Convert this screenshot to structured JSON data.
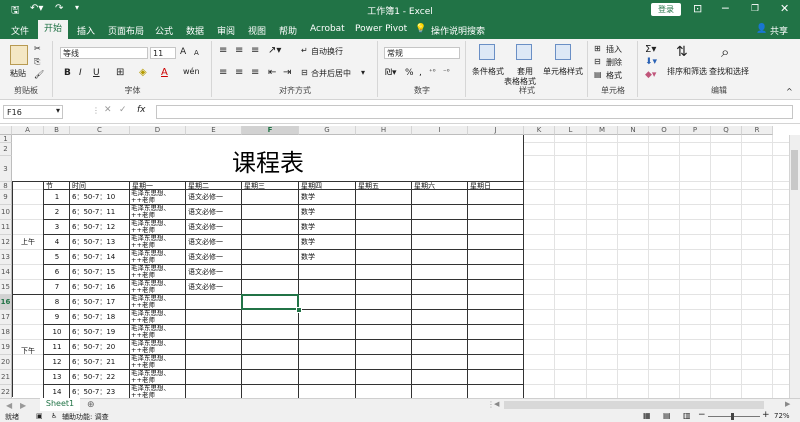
{
  "titlebar": {
    "title": "工作簿1 - Excel",
    "login": "登录",
    "save_icon": "save-icon",
    "undo_icon": "undo-icon",
    "redo_icon": "redo-icon",
    "minimize": "─",
    "restore": "❐",
    "maximize": "☐",
    "close": "✕"
  },
  "tabs": [
    "文件",
    "开始",
    "插入",
    "页面布局",
    "公式",
    "数据",
    "审阅",
    "视图",
    "帮助",
    "Acrobat",
    "Power Pivot"
  ],
  "tell_me": "操作说明搜索",
  "share": "共享",
  "ribbon": {
    "clipboard": {
      "paste": "粘贴",
      "label": "剪贴板"
    },
    "font": {
      "name": "等线",
      "size": "11",
      "bold": "B",
      "italic": "I",
      "underline": "U",
      "grow": "A",
      "shrink": "A",
      "wen": "wén",
      "label": "字体"
    },
    "alignment": {
      "wrap": "自动换行",
      "merge": "合并后居中",
      "label": "对齐方式"
    },
    "number": {
      "format": "常规",
      "label": "数字"
    },
    "styles": {
      "cond": "条件格式",
      "table1": "套用",
      "table2": "表格格式",
      "cell": "单元格样式",
      "label": "样式"
    },
    "cells": {
      "insert": "插入",
      "delete": "删除",
      "format": "格式",
      "label": "单元格"
    },
    "editing": {
      "sort": "排序和筛选",
      "find": "查找和选择",
      "label": "编辑"
    }
  },
  "formula_bar": {
    "name_box": "F16",
    "fx": "fx",
    "value": ""
  },
  "columns": [
    "A",
    "B",
    "C",
    "D",
    "E",
    "F",
    "G",
    "H",
    "I",
    "J",
    "K",
    "L",
    "M",
    "N",
    "O",
    "P",
    "Q",
    "R"
  ],
  "rows": [
    "1",
    "2",
    "3",
    "8",
    "9",
    "10",
    "11",
    "12",
    "13",
    "14",
    "15",
    "16",
    "17",
    "18",
    "19",
    "20",
    "21",
    "22"
  ],
  "sheet": {
    "title": "课程表",
    "headers": [
      "节",
      "时间",
      "星期一",
      "星期二",
      "星期三",
      "星期四",
      "星期五",
      "星期六",
      "星期日"
    ],
    "morning": "上午",
    "afternoon": "下午",
    "rows": [
      {
        "n": "1",
        "time": "6：50-7：10",
        "mon": "毛泽东思想、++老师",
        "tue": "语文必修一",
        "thu": "数学"
      },
      {
        "n": "2",
        "time": "6：50-7：11",
        "mon": "毛泽东思想、++老师",
        "tue": "语文必修一",
        "thu": "数学"
      },
      {
        "n": "3",
        "time": "6：50-7：12",
        "mon": "毛泽东思想、++老师",
        "tue": "语文必修一",
        "thu": "数学"
      },
      {
        "n": "4",
        "time": "6：50-7：13",
        "mon": "毛泽东思想、++老师",
        "tue": "语文必修一",
        "thu": "数学"
      },
      {
        "n": "5",
        "time": "6：50-7：14",
        "mon": "毛泽东思想、++老师",
        "tue": "语文必修一",
        "thu": "数学"
      },
      {
        "n": "6",
        "time": "6：50-7：15",
        "mon": "毛泽东思想、++老师",
        "tue": "语文必修一",
        "thu": ""
      },
      {
        "n": "7",
        "time": "6：50-7：16",
        "mon": "毛泽东思想、++老师",
        "tue": "语文必修一",
        "thu": ""
      },
      {
        "n": "8",
        "time": "6：50-7：17",
        "mon": "毛泽东思想、++老师",
        "tue": "",
        "thu": ""
      },
      {
        "n": "9",
        "time": "6：50-7：18",
        "mon": "毛泽东思想、++老师",
        "tue": "",
        "thu": ""
      },
      {
        "n": "10",
        "time": "6：50-7：19",
        "mon": "毛泽东思想、++老师",
        "tue": "",
        "thu": ""
      },
      {
        "n": "11",
        "time": "6：50-7：20",
        "mon": "毛泽东思想、++老师",
        "tue": "",
        "thu": ""
      },
      {
        "n": "12",
        "time": "6：50-7：21",
        "mon": "毛泽东思想、++老师",
        "tue": "",
        "thu": ""
      },
      {
        "n": "13",
        "time": "6：50-7：22",
        "mon": "毛泽东思想、++老师",
        "tue": "",
        "thu": ""
      },
      {
        "n": "14",
        "time": "6：50-7：23",
        "mon": "毛泽东思想、++老师",
        "tue": "",
        "thu": ""
      }
    ]
  },
  "sheet_tab": "Sheet1",
  "add_sheet": "⊕",
  "status": {
    "ready": "就绪",
    "accessibility": "辅助功能: 调查",
    "zoom": "72%",
    "minus": "−",
    "plus": "+"
  },
  "colors": {
    "accent": "#217346",
    "selected_cell": "#217346"
  }
}
